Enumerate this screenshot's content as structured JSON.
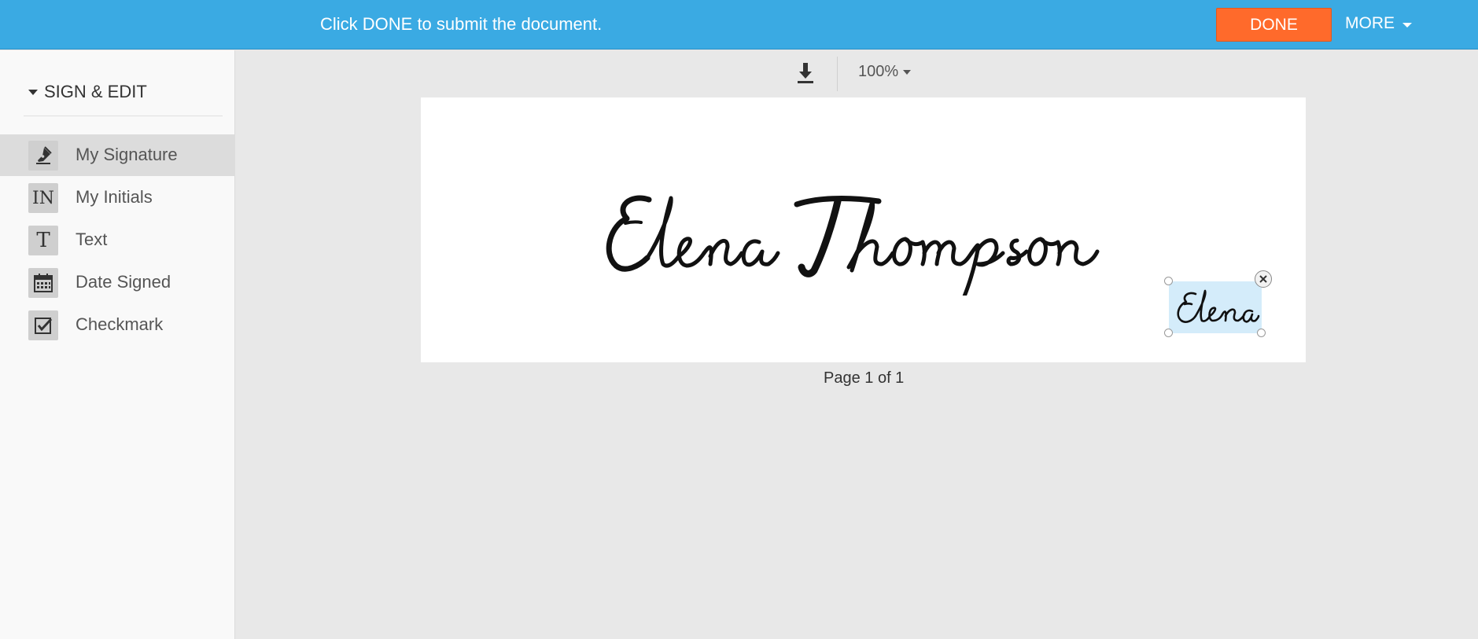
{
  "topbar": {
    "message": "Click DONE to submit the document.",
    "done_label": "DONE",
    "more_label": "MORE"
  },
  "sidebar": {
    "section_title": "SIGN & EDIT",
    "items": [
      {
        "label": "My Signature",
        "icon": "pen-nib-icon",
        "active": true
      },
      {
        "label": "My Initials",
        "icon": "initials-icon",
        "icon_text": "IN"
      },
      {
        "label": "Text",
        "icon": "text-icon",
        "icon_text": "T"
      },
      {
        "label": "Date Signed",
        "icon": "calendar-icon"
      },
      {
        "label": "Checkmark",
        "icon": "checkbox-icon"
      }
    ]
  },
  "toolbar": {
    "zoom": "100%"
  },
  "document": {
    "signature_text": "Elena Thompson",
    "initials_text": "Elena",
    "page_label": "Page 1 of 1"
  },
  "colors": {
    "topbar": "#3aaae3",
    "done_button": "#ff6a2b",
    "initials_highlight": "#d4ecfa"
  }
}
